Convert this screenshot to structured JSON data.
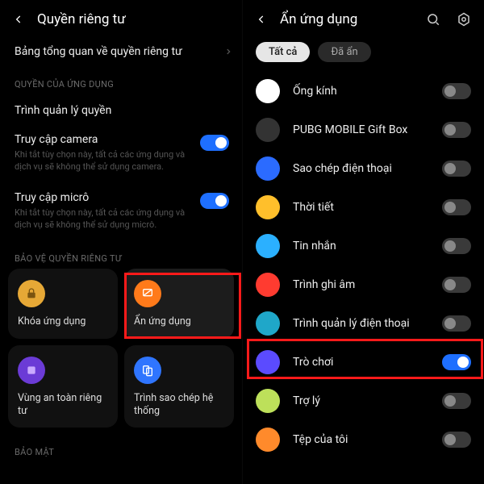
{
  "left": {
    "title": "Quyền riêng tư",
    "overview": "Bảng tổng quan về quyền riêng tư",
    "section_perm": "QUYỀN CỦA ỨNG DỤNG",
    "perm_manager": "Trình quản lý quyền",
    "camera": {
      "title": "Truy cập camera",
      "sub": "Khi tắt tùy chọn này, tất cả các ứng dụng và dịch vụ sẽ không thể sử dụng camera."
    },
    "mic": {
      "title": "Truy cập micrô",
      "sub": "Khi tắt tùy chọn này, tất cả các ứng dụng và dịch vụ sẽ không thể sử dụng micrô."
    },
    "section_protect": "BẢO VỆ QUYỀN RIÊNG TƯ",
    "cards": {
      "lock": "Khóa ứng dụng",
      "hide": "Ẩn ứng dụng",
      "safe": "Vùng an toàn riêng tư",
      "clone": "Trình sao chép hệ thống"
    },
    "section_security": "BẢO MẬT"
  },
  "right": {
    "title": "Ẩn ứng dụng",
    "filter_all": "Tất cả",
    "filter_hidden": "Đã ẩn",
    "apps": [
      {
        "name": "Ống kính",
        "on": false,
        "bg": "#fff"
      },
      {
        "name": "PUBG MOBILE Gift Box",
        "on": false,
        "bg": "#333"
      },
      {
        "name": "Sao chép điện thoại",
        "on": false,
        "bg": "#2b6bff"
      },
      {
        "name": "Thời tiết",
        "on": false,
        "bg": "#ffbf2b"
      },
      {
        "name": "Tin nhắn",
        "on": false,
        "bg": "#2bb0ff"
      },
      {
        "name": "Trình ghi âm",
        "on": false,
        "bg": "#ff3b30"
      },
      {
        "name": "Trình quản lý điện thoại",
        "on": false,
        "bg": "#1fa7c9"
      },
      {
        "name": "Trò chơi",
        "on": true,
        "bg": "#5b4bff"
      },
      {
        "name": "Trợ lý",
        "on": false,
        "bg": "#bde05a"
      },
      {
        "name": "Tệp của tôi",
        "on": false,
        "bg": "#ff8a2b"
      }
    ]
  }
}
